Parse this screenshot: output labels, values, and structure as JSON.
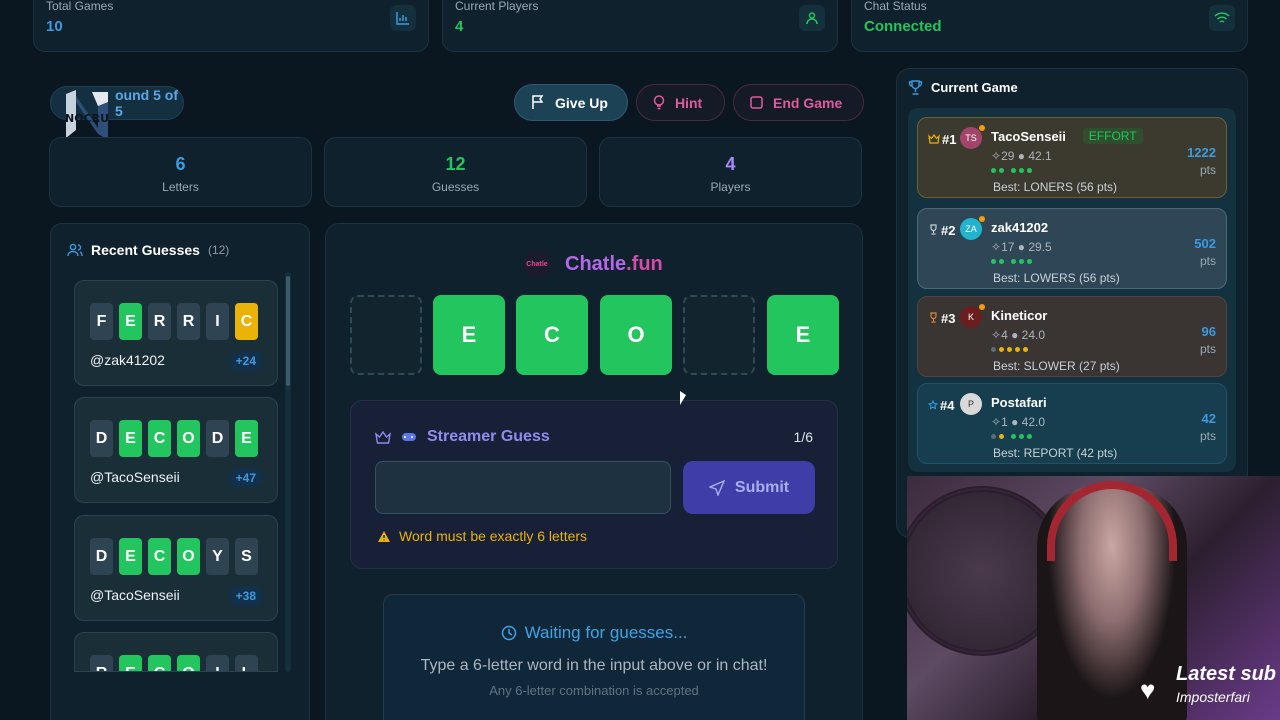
{
  "top_stats": [
    {
      "label": "Total Games",
      "value": "10",
      "color": "#3b9be0"
    },
    {
      "label": "Current Players",
      "value": "4",
      "color": "#22c55e"
    },
    {
      "label": "Chat Status",
      "value": "Connected",
      "color": "#22c55e"
    }
  ],
  "round": {
    "label": "ound 5 of 5"
  },
  "logo_text": "NOCRU",
  "actions": {
    "give_up": "Give Up",
    "hint": "Hint",
    "end_game": "End Game"
  },
  "stats": [
    {
      "value": "6",
      "caption": "Letters",
      "color": "#3b9be0"
    },
    {
      "value": "12",
      "caption": "Guesses",
      "color": "#22c55e"
    },
    {
      "value": "4",
      "caption": "Players",
      "color": "#a78bfa"
    }
  ],
  "recent_guesses": {
    "title": "Recent Guesses",
    "count": "(12)",
    "items": [
      {
        "letters": [
          "F",
          "E",
          "R",
          "R",
          "I",
          "C"
        ],
        "states": [
          "n",
          "c",
          "n",
          "n",
          "n",
          "p"
        ],
        "user": "@zak41202",
        "points": "+24"
      },
      {
        "letters": [
          "D",
          "E",
          "C",
          "O",
          "D",
          "E"
        ],
        "states": [
          "n",
          "c",
          "c",
          "c",
          "n",
          "c"
        ],
        "user": "@TacoSenseii",
        "points": "+47"
      },
      {
        "letters": [
          "D",
          "E",
          "C",
          "O",
          "Y",
          "S"
        ],
        "states": [
          "n",
          "c",
          "c",
          "c",
          "n",
          "n"
        ],
        "user": "@TacoSenseii",
        "points": "+38"
      },
      {
        "letters": [
          "R",
          "E",
          "C",
          "O",
          "I",
          "L"
        ],
        "states": [
          "n",
          "c",
          "c",
          "c",
          "n",
          "n"
        ],
        "user": "",
        "points": ""
      }
    ]
  },
  "brand": {
    "logo": "Chatle",
    "name_a": "Chatle",
    "name_b": ".fun"
  },
  "board": [
    {
      "letter": "",
      "state": "empty"
    },
    {
      "letter": "E",
      "state": "filled"
    },
    {
      "letter": "C",
      "state": "filled"
    },
    {
      "letter": "O",
      "state": "filled"
    },
    {
      "letter": "",
      "state": "empty"
    },
    {
      "letter": "E",
      "state": "filled"
    }
  ],
  "streamer_guess": {
    "title": "Streamer Guess",
    "count": "1/6",
    "input_value": "",
    "submit": "Submit",
    "warning": "Word must be exactly 6 letters"
  },
  "waiting": {
    "title": "Waiting for guesses...",
    "subtitle": "Type a 6-letter word in the input above or in chat!",
    "note": "Any 6-letter combination is accepted"
  },
  "current_game": {
    "title": "Current Game",
    "players": [
      {
        "rank": "#1",
        "rank_icon": "crown-icon",
        "name": "TacoSenseii",
        "badge": "EFFORT",
        "meta": "29 ● 42.1",
        "pips": [
          "c",
          "c",
          "sp-c",
          "c",
          "c"
        ],
        "best": "Best: LONERS (56 pts)",
        "points": "1222",
        "pts_label": "pts",
        "bg": "#3c3a2e",
        "border": "#6b6033",
        "avatar": "TS",
        "avatar_bg": "#a2456a"
      },
      {
        "rank": "#2",
        "rank_icon": "trophy-icon",
        "name": "zak41202",
        "badge": "",
        "meta": "17 ● 29.5",
        "pips": [
          "c",
          "c",
          "sp-c",
          "c",
          "c"
        ],
        "best": "Best: LOWERS (56 pts)",
        "points": "502",
        "pts_label": "pts",
        "bg": "#2e4656",
        "border": "#48687a",
        "avatar": "ZA",
        "avatar_bg": "#22b3cf"
      },
      {
        "rank": "#3",
        "rank_icon": "medal-icon",
        "name": "Kineticor",
        "badge": "",
        "meta": "4 ● 24.0",
        "pips": [
          "g",
          "y",
          "y",
          "y",
          "y"
        ],
        "best": "Best: SLOWER (27 pts)",
        "points": "96",
        "pts_label": "pts",
        "bg": "#3a3432",
        "border": "#4e4440",
        "avatar": "K",
        "avatar_bg": "#6a1e1e"
      },
      {
        "rank": "#4",
        "rank_icon": "star-icon",
        "name": "Postafari",
        "badge": "",
        "meta": "1 ● 42.0",
        "pips": [
          "g",
          "y",
          "sp-c",
          "c",
          "c"
        ],
        "best": "Best: REPORT (42 pts)",
        "points": "42",
        "pts_label": "pts",
        "bg": "#163e4e",
        "border": "#1f5266",
        "avatar": "P",
        "avatar_bg": "#d9d9d9"
      }
    ]
  },
  "overlay": {
    "latest_sub": "Latest sub",
    "subscriber": "Imposterfari"
  }
}
